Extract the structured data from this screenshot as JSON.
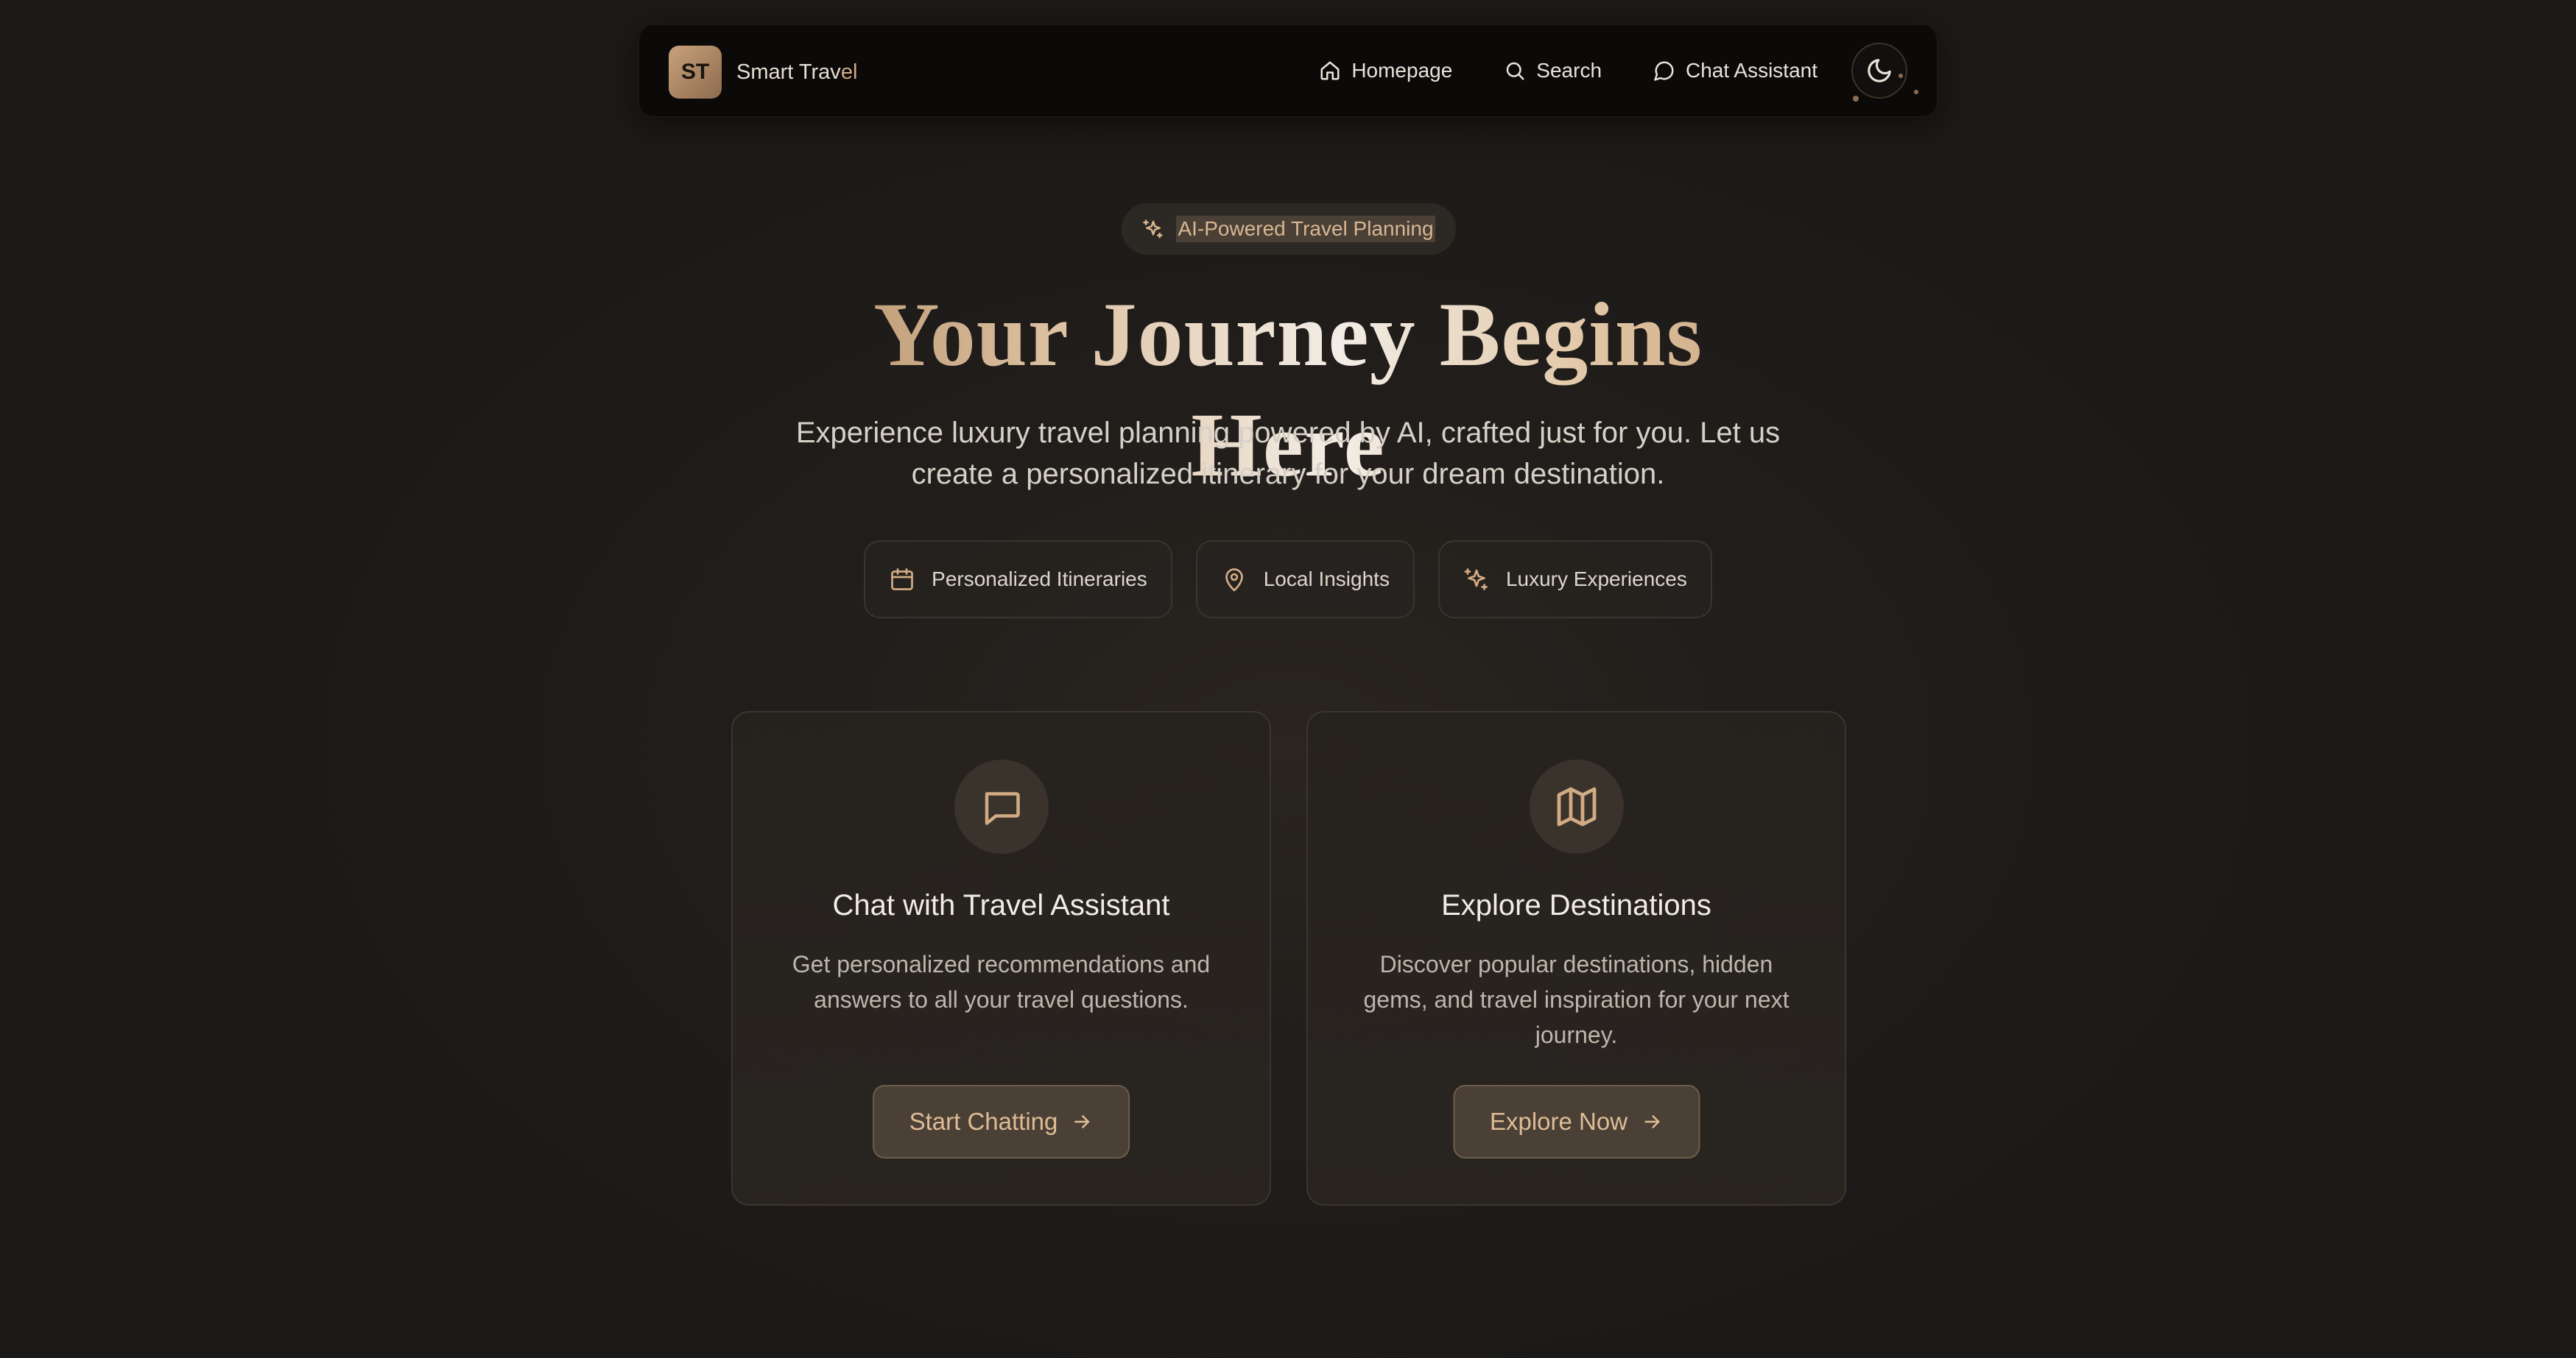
{
  "navbar": {
    "logo_initials": "ST",
    "brand_main": "Smart Trav",
    "brand_accent": "el",
    "links": [
      {
        "label": "Homepage",
        "icon": "home-icon"
      },
      {
        "label": "Search",
        "icon": "search-icon"
      },
      {
        "label": "Chat Assistant",
        "icon": "chat-bubble-icon"
      }
    ],
    "theme_toggle_icon": "moon-icon"
  },
  "hero": {
    "badge": "AI-Powered Travel Planning",
    "badge_icon": "sparkles-icon",
    "title": "Your Journey Begins Here",
    "subtitle_line1": "Experience luxury travel planning powered by AI, crafted just for you. Let us",
    "subtitle_line2": "create a personalized itinerary for your dream destination."
  },
  "features": [
    {
      "label": "Personalized Itineraries",
      "icon": "calendar-icon"
    },
    {
      "label": "Local Insights",
      "icon": "map-pin-icon"
    },
    {
      "label": "Luxury Experiences",
      "icon": "sparkles-icon"
    }
  ],
  "cards": {
    "chat": {
      "icon": "chat-bubble-icon",
      "title": "Chat with Travel Assistant",
      "description": "Get personalized recommendations and answers to all your travel questions.",
      "button": "Start Chatting"
    },
    "explore": {
      "icon": "map-icon",
      "title": "Explore Destinations",
      "description": "Discover popular destinations, hidden gems, and travel inspiration for your next journey.",
      "button": "Explore Now"
    }
  },
  "colors": {
    "accent_gold": "#d1ab84",
    "background": "#211e1b",
    "navbar": "#0b0a09"
  }
}
